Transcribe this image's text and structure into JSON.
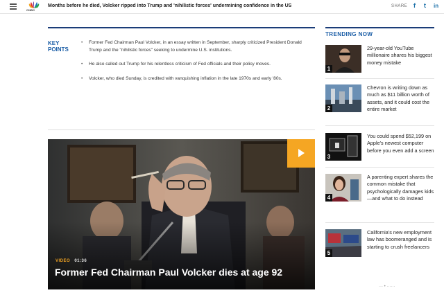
{
  "header": {
    "logo_text": "CNBC",
    "headline": "Months before he died, Volcker ripped into Trump and 'nihilistic forces' undermining confidence in the US",
    "share_label": "SHARE",
    "social": {
      "facebook": "f",
      "twitter": "t",
      "linkedin": "in"
    }
  },
  "key_points": {
    "title": "KEY POINTS",
    "items": [
      "Former Fed Chairman Paul Volcker, in an essay written in September, sharply criticized President Donald Trump and the \"nihilistic forces\" seeking to undermine U.S. institutions.",
      "He also called out Trump for his relentless criticism of Fed officials and their policy moves.",
      "Volcker, who died Sunday, is credited with vanquishing inflation in the late 1970s and early '80s."
    ]
  },
  "video": {
    "label": "VIDEO",
    "duration": "01:36",
    "title": "Former Fed Chairman Paul Volcker dies at age 92"
  },
  "trending": {
    "title": "TRENDING NOW",
    "items": [
      {
        "rank": "1",
        "text": "29-year-old YouTube millionaire shares his biggest money mistake"
      },
      {
        "rank": "2",
        "text": "Chevron is writing down as much as $11 billion worth of assets, and it could cost the entire market"
      },
      {
        "rank": "3",
        "text": "You could spend $52,199 on Apple's newest computer before you even add a screen"
      },
      {
        "rank": "4",
        "text": "A parenting expert shares the common mistake that psychologically damages kids—and what to do instead"
      },
      {
        "rank": "5",
        "text": "California's new employment law has boomeranged and is starting to crush freelancers"
      }
    ]
  },
  "watermark": "··· • ······"
}
